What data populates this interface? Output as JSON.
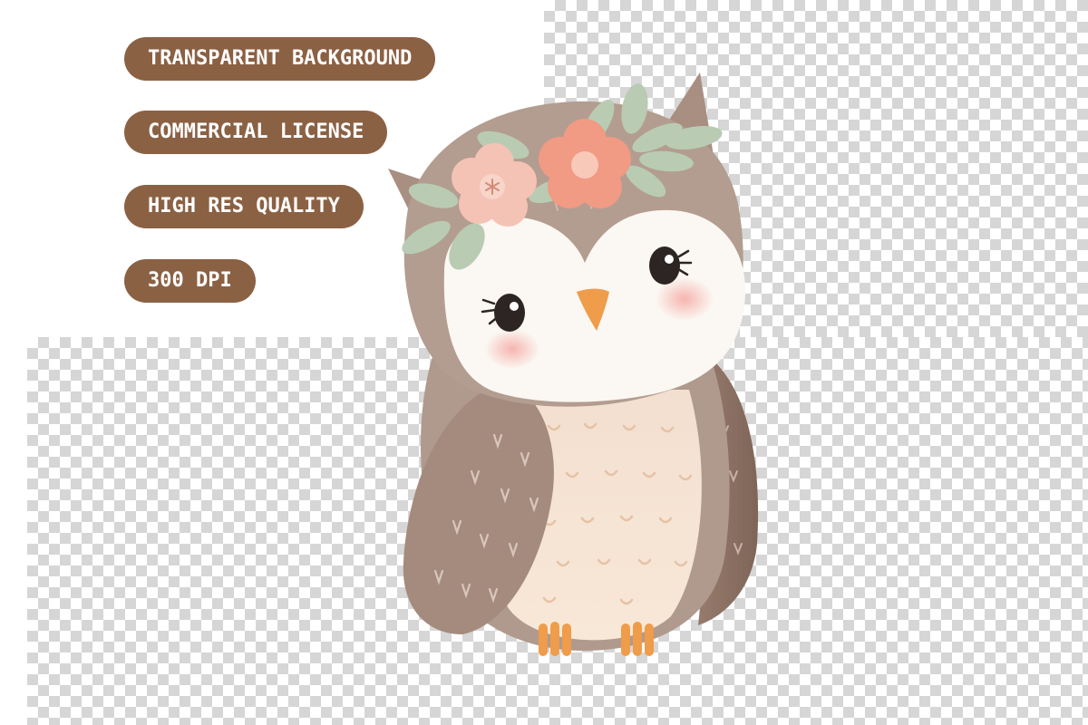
{
  "badges": [
    {
      "label": "TRANSPARENT BACKGROUND"
    },
    {
      "label": "COMMERCIAL LICENSE"
    },
    {
      "label": "HIGH RES QUALITY"
    },
    {
      "label": "300 DPI"
    }
  ],
  "colors": {
    "badge_background": "#8b6144",
    "badge_text": "#ffffff",
    "checker_light": "#ffffff",
    "checker_dark": "#d6d6d6",
    "owl_body_brown": "#a89084",
    "owl_face": "#fbf7f2",
    "owl_belly": "#f6e4d2",
    "owl_beak_feet": "#ef9c4b",
    "flower_pink": "#f4c3b6",
    "flower_coral": "#f19a84",
    "leaf_green": "#b9cbb3"
  },
  "illustration": {
    "subject": "owl-with-flower-crown"
  }
}
